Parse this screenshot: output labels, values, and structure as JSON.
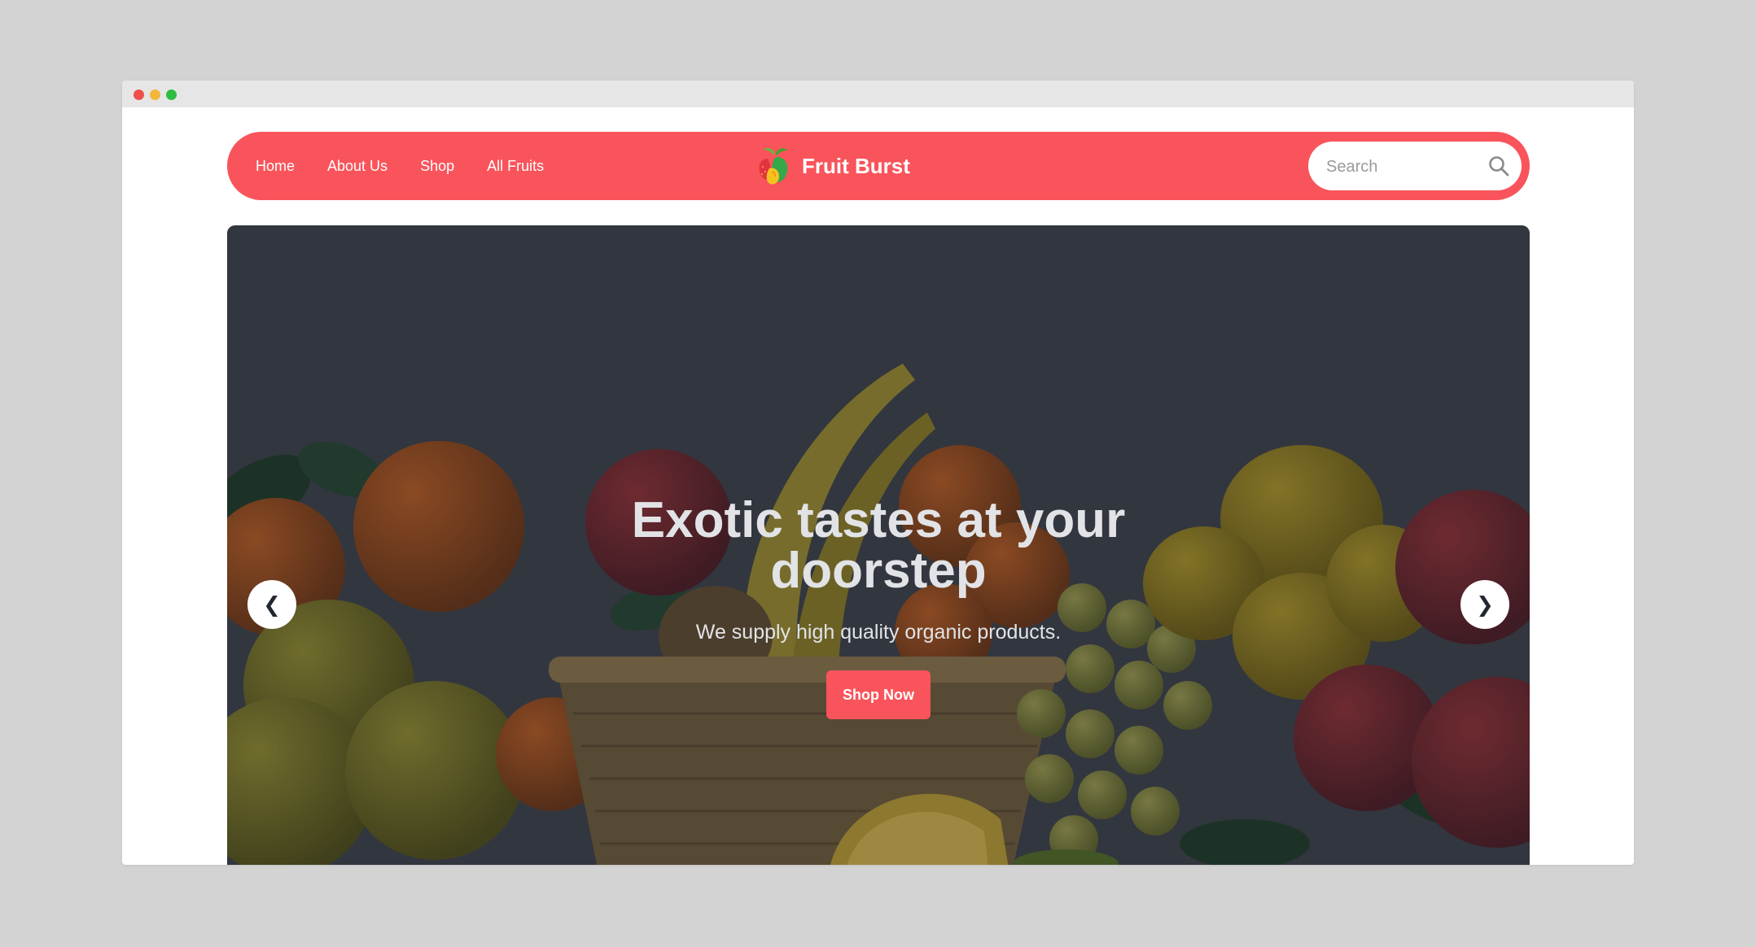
{
  "colors": {
    "accent": "#f9545b",
    "page_background": "#d3d3d3",
    "hero_text": "#e2e3e6"
  },
  "nav": {
    "links": [
      "Home",
      "About Us",
      "Shop",
      "All Fruits"
    ]
  },
  "brand": {
    "name": "Fruit Burst",
    "logo_icon": "fruit-logo-icon"
  },
  "search": {
    "placeholder": "Search",
    "icon": "search-icon"
  },
  "hero": {
    "title": "Exotic tastes at your doorstep",
    "subtitle": "We supply high quality organic products.",
    "cta_label": "Shop Now",
    "prev_label": "❮",
    "next_label": "❯"
  }
}
